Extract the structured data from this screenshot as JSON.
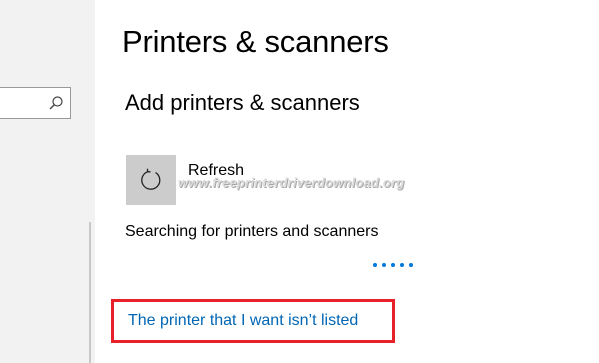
{
  "sidebar": {
    "search": {
      "value": "",
      "icon": "search-icon"
    }
  },
  "main": {
    "page_title": "Printers & scanners",
    "section_title": "Add printers & scanners",
    "refresh": {
      "label": "Refresh",
      "icon": "refresh-icon"
    },
    "watermark": "www.freeprinterdriverdownload.org",
    "status_text": "Searching for printers and scanners",
    "not_listed_link": "The printer that I want isn’t listed"
  },
  "colors": {
    "accent": "#0078d7",
    "link": "#0066b4",
    "highlight_border": "#e8202a",
    "tile": "#cccccc",
    "sidebar": "#f2f2f2"
  }
}
